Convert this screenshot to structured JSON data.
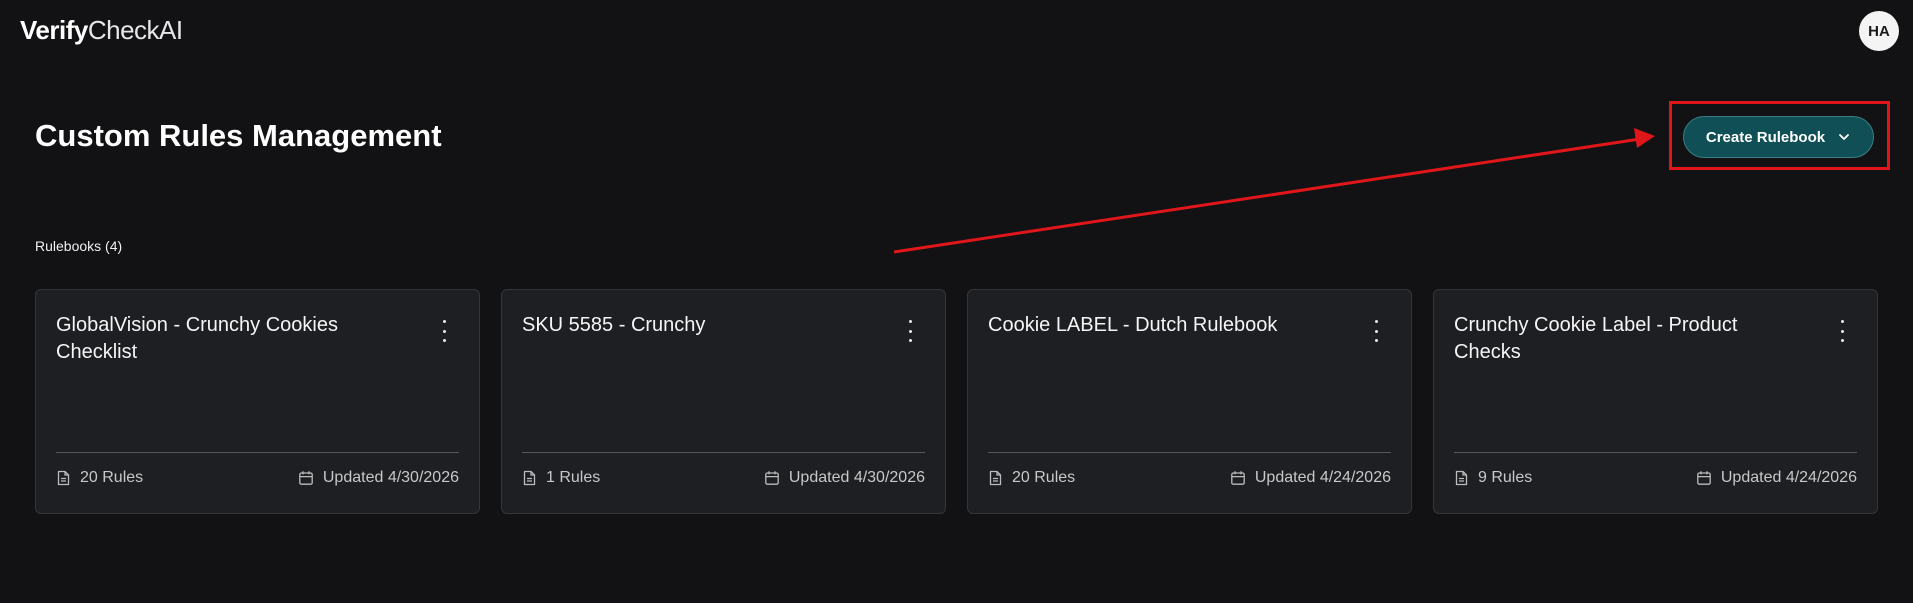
{
  "app": {
    "logo_bold": "Verify",
    "logo_light": "CheckAI",
    "user_initials": "HA"
  },
  "header": {
    "title": "Custom Rules Management",
    "create_button_label": "Create Rulebook"
  },
  "rulebooks": {
    "section_label": "Rulebooks (4)",
    "cards": [
      {
        "title": "GlobalVision - Crunchy Cookies Checklist",
        "rules": "20 Rules",
        "updated": "Updated 4/30/2026"
      },
      {
        "title": "SKU 5585 - Crunchy",
        "rules": "1 Rules",
        "updated": "Updated 4/30/2026"
      },
      {
        "title": "Cookie LABEL - Dutch Rulebook",
        "rules": "20 Rules",
        "updated": "Updated 4/24/2026"
      },
      {
        "title": "Crunchy Cookie Label - Product Checks",
        "rules": "9 Rules",
        "updated": "Updated 4/24/2026"
      }
    ]
  },
  "icons": {
    "menu": "more-vertical-icon",
    "rules": "document-icon",
    "updated": "calendar-icon",
    "dropdown": "chevron-down-icon"
  },
  "colors": {
    "background": "#121214",
    "card": "#1e1f23",
    "accent_button": "#0f4f55",
    "annotation": "#e0161a"
  }
}
